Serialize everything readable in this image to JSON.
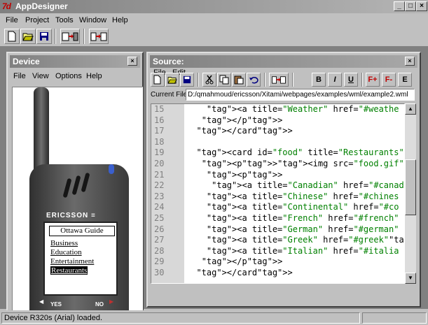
{
  "app": {
    "title": "AppDesigner",
    "logo_text": "7d"
  },
  "window_controls": {
    "minimize": "_",
    "maximize": "□",
    "close": "×"
  },
  "menubar": [
    "File",
    "Project",
    "Tools",
    "Window",
    "Help"
  ],
  "toolbar_icons": [
    "new-file-icon",
    "open-folder-icon",
    "save-icon",
    "deploy-to-device-icon",
    "deploy-source-icon"
  ],
  "device_panel": {
    "title": "Device",
    "close_label": "×",
    "menu": [
      "File",
      "View",
      "Options",
      "Help"
    ],
    "phone": {
      "brand": "ERICSSON ≡",
      "screen_title": "Ottawa Guide",
      "links": [
        "Business",
        "Education",
        "Entertainment",
        "Restaurants"
      ],
      "selected_index": 3,
      "left_key": "YES",
      "right_key": "NO"
    }
  },
  "source_panel": {
    "title": "Source:",
    "close_label": "×",
    "menu": [
      "File",
      "Edit"
    ],
    "toolbar": [
      "new-icon",
      "open-icon",
      "save-icon",
      "cut-icon",
      "copy-icon",
      "paste-icon",
      "undo-icon",
      "deploy-icon",
      "B",
      "I",
      "U",
      "F+",
      "F-",
      "E"
    ],
    "current_file_label": "Current File:",
    "current_file": "D:/qmahmoud/ericsson/Xitami/webpages/examples/wml/example2.wml",
    "lines": [
      {
        "n": "15",
        "text": "    <a title=\"Weather\" href=\"#weathe"
      },
      {
        "n": "16",
        "text": "   </p>"
      },
      {
        "n": "17",
        "text": "  </card>"
      },
      {
        "n": "18",
        "text": ""
      },
      {
        "n": "19",
        "text": "  <card id=\"food\" title=\"Restaurants\">"
      },
      {
        "n": "20",
        "text": "   <p><img src=\"food.gif\" alt=\"\"/></p>"
      },
      {
        "n": "21",
        "text": "    <p>"
      },
      {
        "n": "22",
        "text": "     <a title=\"Canadian\" href=\"#canad"
      },
      {
        "n": "23",
        "text": "    <a title=\"Chinese\" href=\"#chines"
      },
      {
        "n": "24",
        "text": "    <a title=\"Continental\" href=\"#co"
      },
      {
        "n": "25",
        "text": "    <a title=\"French\" href=\"#french\""
      },
      {
        "n": "26",
        "text": "    <a title=\"German\" href=\"#german\""
      },
      {
        "n": "27",
        "text": "    <a title=\"Greek\" href=\"#greek\">G"
      },
      {
        "n": "28",
        "text": "    <a title=\"Italian\" href=\"#italia"
      },
      {
        "n": "29",
        "text": "   </p>"
      },
      {
        "n": "30",
        "text": "  </card>"
      }
    ]
  },
  "statusbar": {
    "text": "Device R320s (Arial) loaded."
  }
}
